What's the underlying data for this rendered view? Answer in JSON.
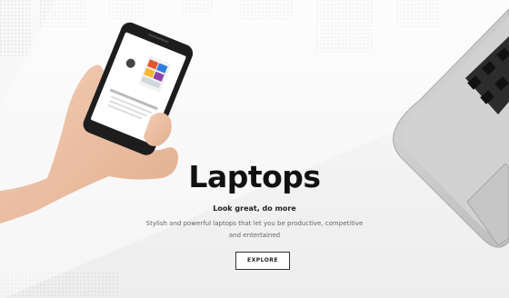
{
  "hero": {
    "title": "Laptops",
    "tagline": "Look great, do more",
    "description_line1": "Stylish and powerful laptops that let you be productive, competitive",
    "description_line2": "and entertained",
    "cta_label": "EXPLORE"
  },
  "colors": {
    "background": "#ffffff",
    "text": "#111111",
    "muted_text": "#666666",
    "button_border": "#333333"
  }
}
